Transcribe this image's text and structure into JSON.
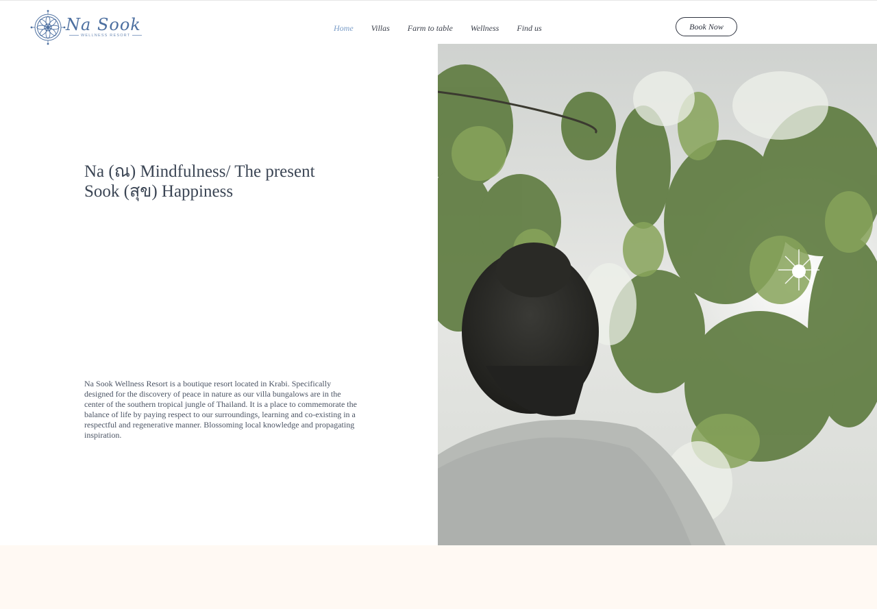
{
  "brand": {
    "logo_script": "Na Sook",
    "logo_subtitle": "WELLNESS RESORT"
  },
  "nav": {
    "items": [
      {
        "label": "Home",
        "active": true
      },
      {
        "label": "Villas",
        "active": false
      },
      {
        "label": "Farm to table",
        "active": false
      },
      {
        "label": "Wellness",
        "active": false
      },
      {
        "label": "Find us",
        "active": false
      }
    ],
    "book_label": "Book Now"
  },
  "hero": {
    "title_line1": "Na (ณ) Mindfulness/ The present",
    "title_line2": "Sook (สุข) Happiness",
    "description": "Na Sook Wellness Resort is a boutique resort located in Krabi.  Specifically designed for the discovery of peace in nature as our villa bungalows are in the center of the southern tropical jungle of Thailand. It is a place to commemorate the balance of life by paying respect to our surroundings, learning and co-existing in a respectful and regenerative manner. Blossoming local knowledge and propagating inspiration."
  },
  "colors": {
    "accent": "#7a9dc8",
    "text_dark": "#3b4554",
    "logo_blue": "#4c6fa0",
    "band": "#fff9f3"
  },
  "icons": {
    "logo_mark": "compass-mandala-icon"
  }
}
